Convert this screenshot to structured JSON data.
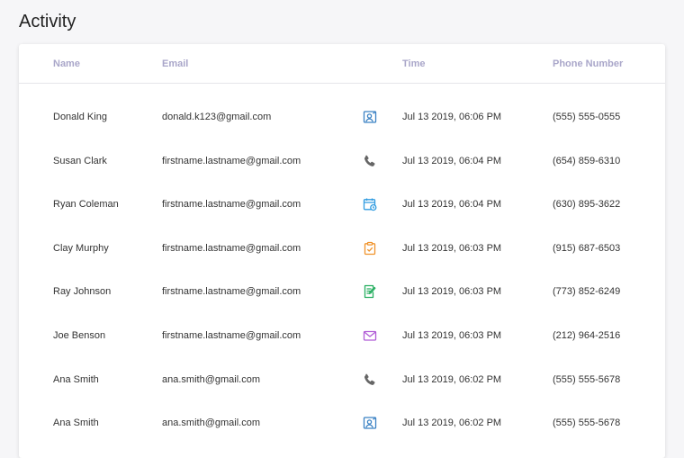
{
  "page": {
    "title": "Activity"
  },
  "table": {
    "columns": {
      "name": "Name",
      "email": "Email",
      "time": "Time",
      "phone": "Phone Number"
    },
    "rows": [
      {
        "name": "Donald King",
        "email": "donald.k123@gmail.com",
        "icon": "contact-card-icon",
        "icon_color": "#3b82c4",
        "time": "Jul 13 2019, 06:06 PM",
        "phone": "(555) 555-0555"
      },
      {
        "name": "Susan Clark",
        "email": "firstname.lastname@gmail.com",
        "icon": "phone-icon",
        "icon_color": "#666666",
        "time": "Jul 13 2019, 06:04 PM",
        "phone": "(654) 859-6310"
      },
      {
        "name": "Ryan Coleman",
        "email": "firstname.lastname@gmail.com",
        "icon": "calendar-clock-icon",
        "icon_color": "#2f9be0",
        "time": "Jul 13 2019, 06:04 PM",
        "phone": "(630) 895-3622"
      },
      {
        "name": "Clay Murphy",
        "email": "firstname.lastname@gmail.com",
        "icon": "clipboard-check-icon",
        "icon_color": "#f0932b",
        "time": "Jul 13 2019, 06:03 PM",
        "phone": "(915) 687-6503"
      },
      {
        "name": "Ray Johnson",
        "email": "firstname.lastname@gmail.com",
        "icon": "note-edit-icon",
        "icon_color": "#27ae60",
        "time": "Jul 13 2019, 06:03 PM",
        "phone": "(773) 852-6249"
      },
      {
        "name": "Joe Benson",
        "email": "firstname.lastname@gmail.com",
        "icon": "envelope-icon",
        "icon_color": "#b05cd6",
        "time": "Jul 13 2019, 06:03 PM",
        "phone": "(212) 964-2516"
      },
      {
        "name": "Ana Smith",
        "email": "ana.smith@gmail.com",
        "icon": "phone-icon",
        "icon_color": "#666666",
        "time": "Jul 13 2019, 06:02 PM",
        "phone": "(555) 555-5678"
      },
      {
        "name": "Ana Smith",
        "email": "ana.smith@gmail.com",
        "icon": "contact-card-icon",
        "icon_color": "#3b82c4",
        "time": "Jul 13 2019, 06:02 PM",
        "phone": "(555) 555-5678"
      }
    ]
  }
}
